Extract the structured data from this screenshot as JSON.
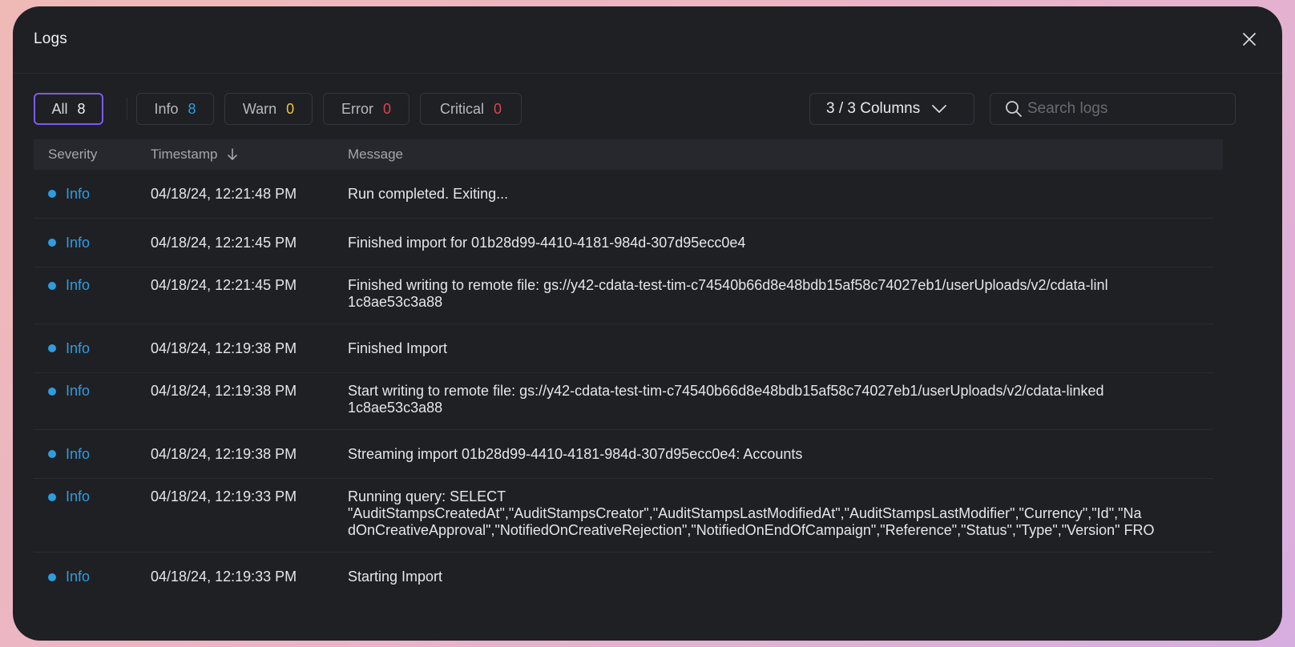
{
  "modal": {
    "title": "Logs",
    "close_icon": "close-icon"
  },
  "filters": [
    {
      "label": "All",
      "count": "8",
      "color": "#f2f2f4",
      "active": true
    },
    {
      "label": "Info",
      "count": "8",
      "color": "#2f9ce0",
      "active": false
    },
    {
      "label": "Warn",
      "count": "0",
      "color": "#e8c547",
      "active": false
    },
    {
      "label": "Error",
      "count": "0",
      "color": "#d9464b",
      "active": false
    },
    {
      "label": "Critical",
      "count": "0",
      "color": "#d9464b",
      "active": false
    }
  ],
  "columns_dropdown": {
    "label": "3 / 3 Columns",
    "icon": "chevron-down-icon"
  },
  "search": {
    "placeholder": "Search logs",
    "value": "",
    "icon": "search-icon"
  },
  "table": {
    "headers": {
      "severity": "Severity",
      "timestamp": "Timestamp",
      "message": "Message",
      "sort_icon": "arrow-down-icon"
    },
    "rows": [
      {
        "severity": "Info",
        "timestamp": "04/18/24, 12:21:48 PM",
        "message": [
          "Run completed. Exiting..."
        ]
      },
      {
        "severity": "Info",
        "timestamp": "04/18/24, 12:21:45 PM",
        "message": [
          "Finished import for 01b28d99-4410-4181-984d-307d95ecc0e4"
        ]
      },
      {
        "severity": "Info",
        "timestamp": "04/18/24, 12:21:45 PM",
        "message": [
          "Finished writing to remote file: gs://y42-cdata-test-tim-c74540b66d8e48bdb15af58c74027eb1/userUploads/v2/cdata-linl",
          "1c8ae53c3a88"
        ]
      },
      {
        "severity": "Info",
        "timestamp": "04/18/24, 12:19:38 PM",
        "message": [
          "Finished Import"
        ]
      },
      {
        "severity": "Info",
        "timestamp": "04/18/24, 12:19:38 PM",
        "message": [
          "Start writing to remote file: gs://y42-cdata-test-tim-c74540b66d8e48bdb15af58c74027eb1/userUploads/v2/cdata-linked",
          "1c8ae53c3a88"
        ]
      },
      {
        "severity": "Info",
        "timestamp": "04/18/24, 12:19:38 PM",
        "message": [
          "Streaming import 01b28d99-4410-4181-984d-307d95ecc0e4: Accounts"
        ]
      },
      {
        "severity": "Info",
        "timestamp": "04/18/24, 12:19:33 PM",
        "message": [
          "Running query: SELECT",
          "\"AuditStampsCreatedAt\",\"AuditStampsCreator\",\"AuditStampsLastModifiedAt\",\"AuditStampsLastModifier\",\"Currency\",\"Id\",\"Na",
          "dOnCreativeApproval\",\"NotifiedOnCreativeRejection\",\"NotifiedOnEndOfCampaign\",\"Reference\",\"Status\",\"Type\",\"Version\" FRO"
        ]
      },
      {
        "severity": "Info",
        "timestamp": "04/18/24, 12:19:33 PM",
        "message": [
          "Starting Import"
        ]
      }
    ]
  },
  "colors": {
    "info": "#2f9ce0",
    "warn": "#e8c547",
    "error": "#d9464b",
    "accent": "#7c5bea"
  }
}
